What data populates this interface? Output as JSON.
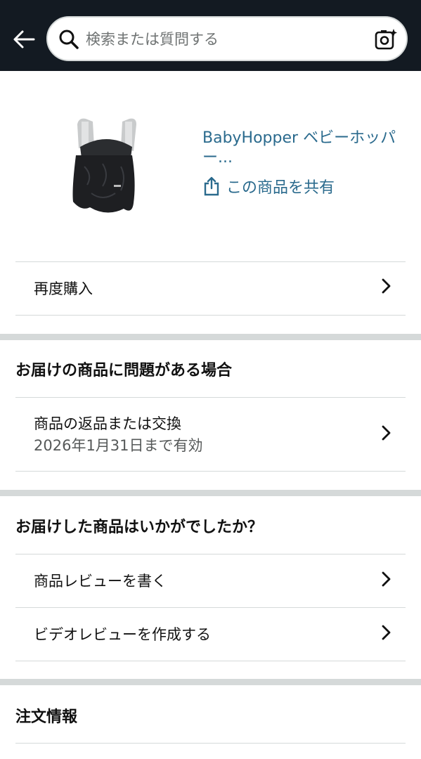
{
  "header": {
    "search": {
      "placeholder": "検索または質問する"
    }
  },
  "product": {
    "title": "BabyHopper ベビーホッパー...",
    "share_label": "この商品を共有"
  },
  "actions": {
    "buy_again": "再度購入"
  },
  "issue_section": {
    "title": "お届けの商品に問題がある場合",
    "return_label": "商品の返品または交換",
    "return_deadline": "2026年1月31日まで有効"
  },
  "feedback_section": {
    "title": "お届けした商品はいかがでしたか？",
    "write_review": "商品レビューを書く",
    "video_review": "ビデオレビューを作成する"
  },
  "order_info": {
    "title": "注文情報"
  },
  "colors": {
    "header_bg": "#131a22",
    "link": "#2a6a8d",
    "divider": "#d5d9d9"
  }
}
